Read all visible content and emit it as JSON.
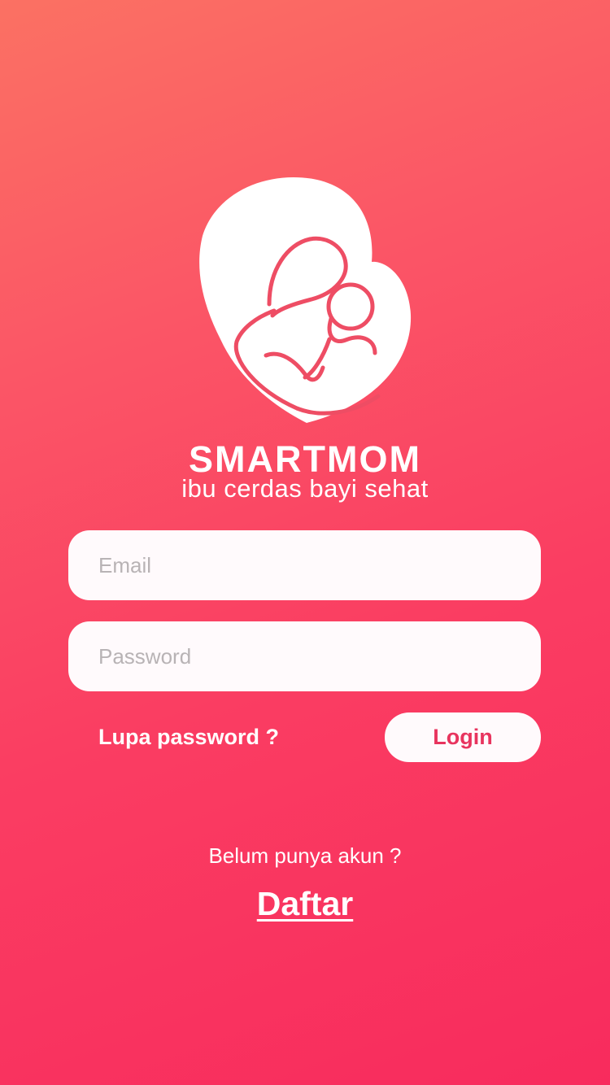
{
  "app": {
    "name": "SMARTMOM",
    "tagline": "ibu cerdas bayi sehat",
    "logo_icon": "mother-and-baby-icon"
  },
  "login_form": {
    "email_placeholder": "Email",
    "password_placeholder": "Password",
    "forgot_password_label": "Lupa password ?",
    "login_button_label": "Login"
  },
  "signup": {
    "prompt": "Belum punya akun ?",
    "link_label": "Daftar"
  },
  "colors": {
    "gradient_start": "#fb7163",
    "gradient_end": "#f82b5d",
    "accent": "#e8345e",
    "field_background": "#fffafc"
  }
}
